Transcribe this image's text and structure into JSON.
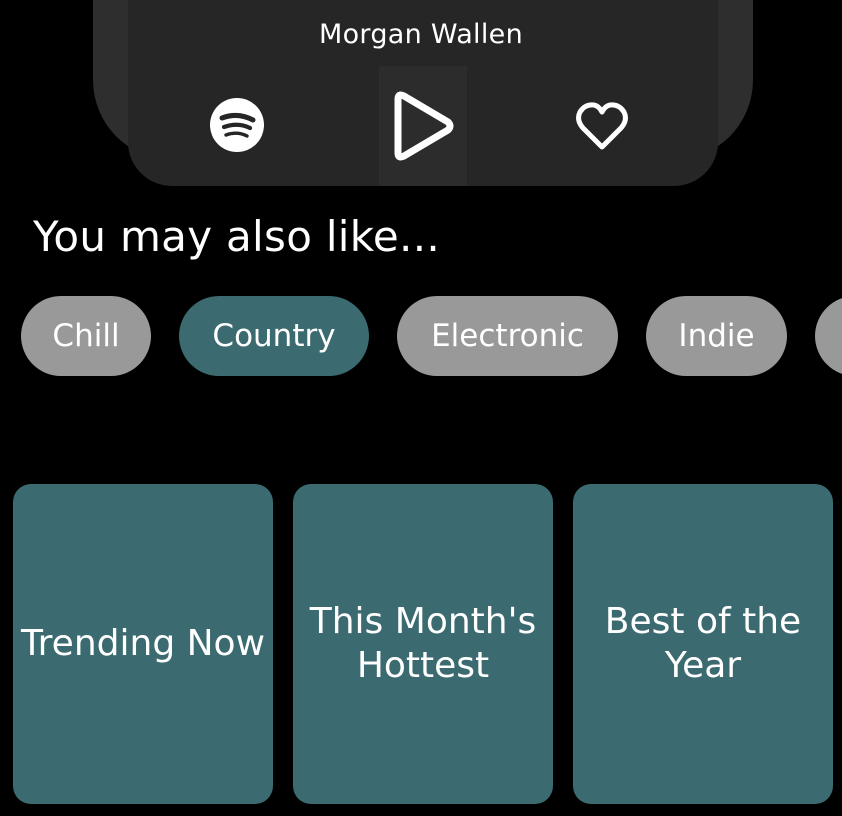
{
  "now_playing": {
    "title_partial": "",
    "artist": "Morgan Wallen",
    "icons": {
      "spotify": "spotify-icon",
      "play": "play-icon",
      "like": "heart-icon"
    }
  },
  "recommendations": {
    "heading": "You may also like...",
    "genres": [
      {
        "label": "Chill",
        "selected": false
      },
      {
        "label": "Country",
        "selected": true
      },
      {
        "label": "Electronic",
        "selected": false
      },
      {
        "label": "Indie",
        "selected": false
      },
      {
        "label": "",
        "selected": false
      }
    ],
    "playlists": [
      {
        "label": "Trending Now"
      },
      {
        "label": "This Month's Hottest"
      },
      {
        "label": "Best of the Year"
      }
    ]
  },
  "colors": {
    "background": "#000000",
    "card": "#262626",
    "accent": "#3b6a70",
    "chip_default": "#9a9999"
  }
}
